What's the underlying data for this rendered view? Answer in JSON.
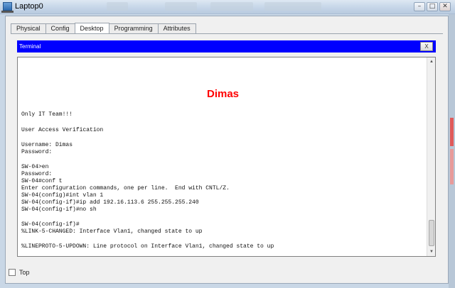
{
  "window": {
    "title": "Laptop0",
    "minimize_icon": "minimize-icon",
    "maximize_icon": "maximize-icon",
    "close_icon": "close-icon",
    "minimize_glyph": "–",
    "maximize_glyph": "□",
    "close_glyph": "✕"
  },
  "tabs": [
    {
      "label": "Physical",
      "active": false
    },
    {
      "label": "Config",
      "active": false
    },
    {
      "label": "Desktop",
      "active": true
    },
    {
      "label": "Programming",
      "active": false
    },
    {
      "label": "Attributes",
      "active": false
    }
  ],
  "terminal": {
    "title": "Terminal",
    "close_label": "X",
    "heading": "Dimas",
    "heading_color": "#ff0000",
    "header_color": "#0000ff",
    "lines": [
      "Only IT Team!!!",
      "User Access Verification",
      "Username: Dimas",
      "Password:",
      "SW-04>en",
      "Password:",
      "SW-04#conf t",
      "Enter configuration commands, one per line.  End with CNTL/Z.",
      "SW-04(config)#int vlan 1",
      "SW-04(config-if)#ip add 192.16.113.6 255.255.255.240",
      "SW-04(config-if)#no sh",
      "SW-04(config-if)#",
      "%LINK-5-CHANGED: Interface Vlan1, changed state to up",
      "%LINEPROTO-5-UPDOWN: Line protocol on Interface Vlan1, changed state to up"
    ]
  },
  "footer": {
    "top_checkbox_label": "Top",
    "top_checked": false
  }
}
